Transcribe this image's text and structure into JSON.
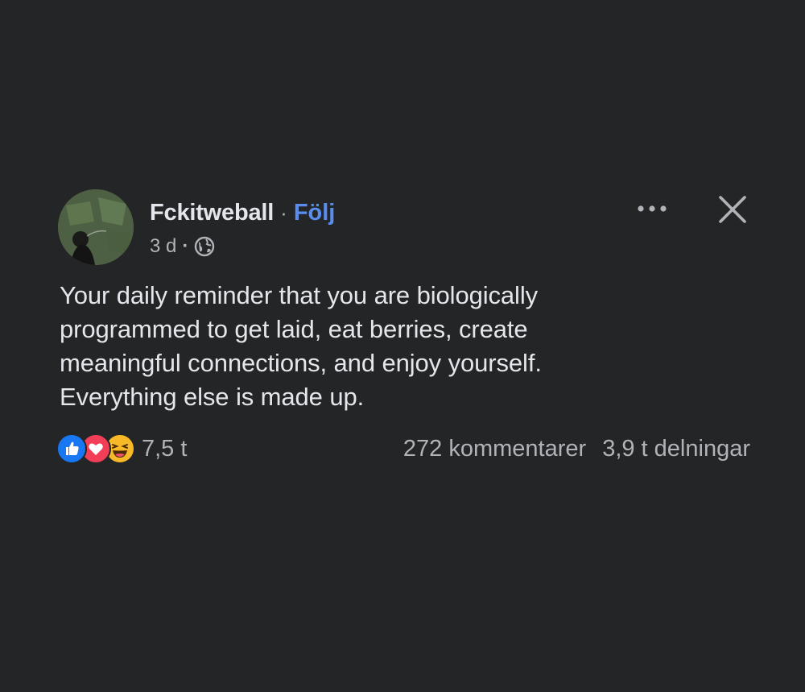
{
  "post": {
    "author": "Fckitweball",
    "separator": "·",
    "follow_label": "Följ",
    "timestamp": "3 d",
    "meta_separator": "·",
    "audience_icon": "globe-icon",
    "more_icon": "more-horizontal-icon",
    "close_icon": "close-icon",
    "text_lines": [
      "Your daily reminder that you are biologically",
      "programmed to get laid, eat berries, create",
      "meaningful connections, and enjoy yourself.",
      "Everything else is made up."
    ]
  },
  "reactions": {
    "icons": [
      "like-icon",
      "love-icon",
      "haha-icon"
    ],
    "count": "7,5 t"
  },
  "stats": {
    "comments": "272 kommentarer",
    "shares": "3,9 t delningar"
  },
  "colors": {
    "background": "#232527",
    "text": "#e4e6eb",
    "secondary_text": "#b0b3b8",
    "link": "#5a8dee",
    "like": "#1877f2",
    "love": "#f33e58",
    "haha": "#f7b928"
  }
}
